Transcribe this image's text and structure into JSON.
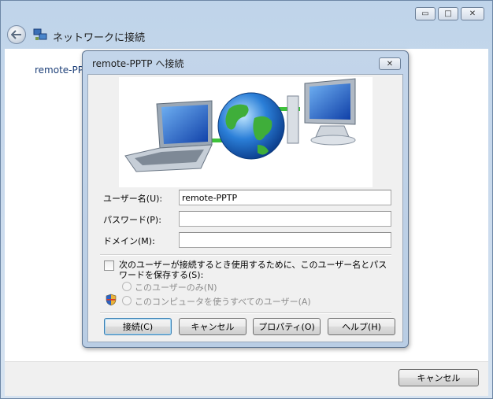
{
  "outer": {
    "title": "ネットワークに接続",
    "item_text": "remote-PP",
    "cancel_label": "キャンセル",
    "controls": {
      "minimize": "▭",
      "maximize": "□",
      "close": "✕"
    }
  },
  "dialog": {
    "title": "remote-PPTP へ接続",
    "close_glyph": "✕",
    "fields": {
      "username_label": "ユーザー名(U):",
      "username_value": "remote-PPTP",
      "password_label": "パスワード(P):",
      "password_value": "",
      "domain_label": "ドメイン(M):",
      "domain_value": ""
    },
    "save_checkbox": {
      "label": "次のユーザーが接続するとき使用するために、このユーザー名とパスワードを保存する(S):",
      "checked": false
    },
    "radio_options": [
      {
        "label": "このユーザーのみ(N)",
        "enabled": false
      },
      {
        "label": "このコンピュータを使うすべてのユーザー(A)",
        "enabled": false
      }
    ],
    "buttons": {
      "connect": "接続(C)",
      "cancel": "キャンセル",
      "properties": "プロパティ(O)",
      "help": "ヘルプ(H)"
    }
  },
  "icons": {
    "back": "back-arrow-icon",
    "network": "network-icon",
    "banner": "laptop-globe-computer-icon",
    "shield": "uac-shield-icon"
  },
  "colors": {
    "frame_blue": "#c3d5ea",
    "link_blue": "#1c3f78",
    "cable_green": "#3ec23a"
  }
}
